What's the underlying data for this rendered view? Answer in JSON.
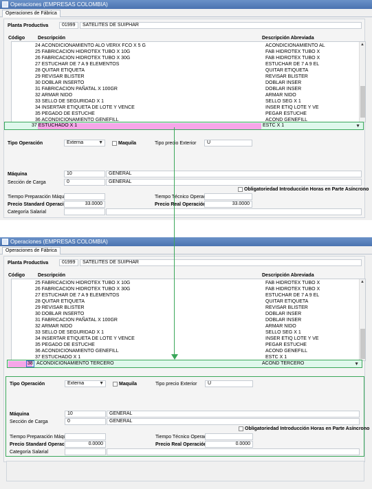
{
  "window": {
    "title": "Operaciones (EMPRESAS COLOMBIA)",
    "tab": "Operaciones de Fábrica"
  },
  "planta": {
    "label": "Planta Productiva",
    "code": "01999",
    "name": "SATELITES DE  SUIPHAR"
  },
  "columns": {
    "code": "Código",
    "desc": "Descripción",
    "abbr": "Descripción Abreviada"
  },
  "list1": [
    {
      "desc": "24 ACONDICIONAMIENTO ALO VERIX FCO X 5 G",
      "abbr": "ACONDICIONAMIENTO AL"
    },
    {
      "desc": "25 FABRICACION HIDROTEX TUBO X 10G",
      "abbr": "FAB HIDROTEX TUBO X"
    },
    {
      "desc": "26 FABRICACION HIDROTEX TUBO X 30G",
      "abbr": "FAB HIDROTEX TUBO X"
    },
    {
      "desc": "27 ESTUCHAR DE 7 A 9 ELEMENTOS",
      "abbr": "ESTUCHAR DE 7 A 9 EL"
    },
    {
      "desc": "28 QUITAR ETIQUETA",
      "abbr": "QUITAR ETIQUETA"
    },
    {
      "desc": "29 REVISAR BLISTER",
      "abbr": "REVISAR BLISTER"
    },
    {
      "desc": "30 DOBLAR INSERTO",
      "abbr": "DOBLAR INSER"
    },
    {
      "desc": "31 FABRICACION PAÑATAL X 100GR",
      "abbr": "DOBLAR INSER"
    },
    {
      "desc": "32 ARMAR NIDO",
      "abbr": "ARMAR NIDO"
    },
    {
      "desc": "33 SELLO DE SEGURIDAD X 1",
      "abbr": "SELLO SEG X 1"
    },
    {
      "desc": "34 INSERTAR ETIQUETA DE LOTE Y VENCE",
      "abbr": "INSER ETIQ LOTE Y VE"
    },
    {
      "desc": "35 PEGADO DE ESTUCHE",
      "abbr": "PEGAR ESTUCHE"
    },
    {
      "desc": "36 ACONDICIONAMIENTO GENEFILL",
      "abbr": "ACOND GENEFILL"
    }
  ],
  "edit1": {
    "desc": "37 ESTUCHADO X 1",
    "abbr": "ESTC X 1"
  },
  "list2": [
    {
      "desc": "25 FABRICACION HIDROTEX TUBO X 10G",
      "abbr": "FAB HIDROTEX TUBO X"
    },
    {
      "desc": "26 FABRICACION HIDROTEX TUBO X 30G",
      "abbr": "FAB HIDROTEX TUBO X"
    },
    {
      "desc": "27 ESTUCHAR DE 7 A 9 ELEMENTOS",
      "abbr": "ESTUCHAR DE 7 A 9 EL"
    },
    {
      "desc": "28 QUITAR ETIQUETA",
      "abbr": "QUITAR ETIQUETA"
    },
    {
      "desc": "29 REVISAR BLISTER",
      "abbr": "REVISAR BLISTER"
    },
    {
      "desc": "30 DOBLAR INSERTO",
      "abbr": "DOBLAR INSER"
    },
    {
      "desc": "31 FABRICACION PAÑATAL X 100GR",
      "abbr": "DOBLAR INSER"
    },
    {
      "desc": "32 ARMAR NIDO",
      "abbr": "ARMAR NIDO"
    },
    {
      "desc": "33 SELLO DE SEGURIDAD X 1",
      "abbr": "SELLO SEG X 1"
    },
    {
      "desc": "34 INSERTAR ETIQUETA DE LOTE Y VENCE",
      "abbr": "INSER ETIQ LOTE Y VE"
    },
    {
      "desc": "35 PEGADO DE ESTUCHE",
      "abbr": "PEGAR ESTUCHE"
    },
    {
      "desc": "36 ACONDICIONAMIENTO GENEFILL",
      "abbr": "ACOND GENEFILL"
    },
    {
      "desc": "37 ESTUCHADO X 1",
      "abbr": "ESTC X 1"
    }
  ],
  "edit2": {
    "code": "38",
    "desc": "ACONDICIONAMIENTO TERCERO",
    "abbr": "ACOND TERCERO"
  },
  "form": {
    "tipo_op_label": "Tipo Operación",
    "tipo_op_value": "Externa",
    "maquila_label": "Maquila",
    "tipo_precio_label": "Tipo precio Exterior",
    "tipo_precio_value": "U",
    "maquina_label": "Máquina",
    "maquina_code": "10",
    "maquina_name": "GENERAL",
    "seccion_label": "Sección de Carga",
    "seccion_code": "0",
    "seccion_name": "GENERAL",
    "obligatoriedad_label": "Obligatoriedad Introducción Horas en Parte Asíncrono",
    "tprep_label": "Tiempo Preparación Máquina",
    "ttec_label": "Tiempo Técnico Operación",
    "pstd_label": "Precio Standard Operación",
    "preal_label": "Precio Real Operación",
    "cat_label": "Categoría Salarial"
  },
  "values1": {
    "pstd": "33.0000",
    "preal": "33.0000"
  },
  "values2": {
    "pstd": "0.0000",
    "preal": "0.0000"
  },
  "colors": {
    "title": "#4a73b0",
    "highlight_border": "#3aa75a",
    "edit_bg": "#dff8ec",
    "edit_pink": "#f6a6e8"
  }
}
